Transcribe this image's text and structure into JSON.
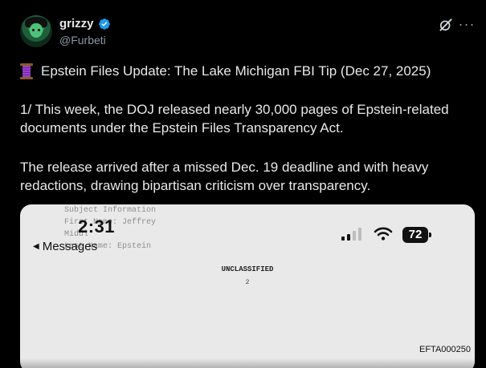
{
  "author": {
    "display_name": "grizzy",
    "handle": "@Furbeti",
    "verified_color": "#1d9bf0"
  },
  "actions": {
    "grok_icon": "grok-icon",
    "more_icon": "more-icon",
    "more_label": "···"
  },
  "post": {
    "title": "Epstein Files Update: The Lake Michigan FBI Tip (Dec 27, 2025)",
    "paragraph_1": "1/ This week, the DOJ released nearly 30,000 pages of Epstein-related documents under the Epstein Files Transparency Act.",
    "paragraph_2": "The release arrived after a missed Dec. 19 deadline and with heavy redactions, drawing bipartisan criticism over transparency."
  },
  "media": {
    "faded_lines": [
      "Subject Information",
      "First Name: Jeffrey",
      "Middl",
      "Last Name: Epstein"
    ],
    "clock": "2:31",
    "back_label": "Messages",
    "battery": "72",
    "classification": "UNCLASSIFIED",
    "page_number": "2",
    "doc_id": "EFTA000250"
  }
}
